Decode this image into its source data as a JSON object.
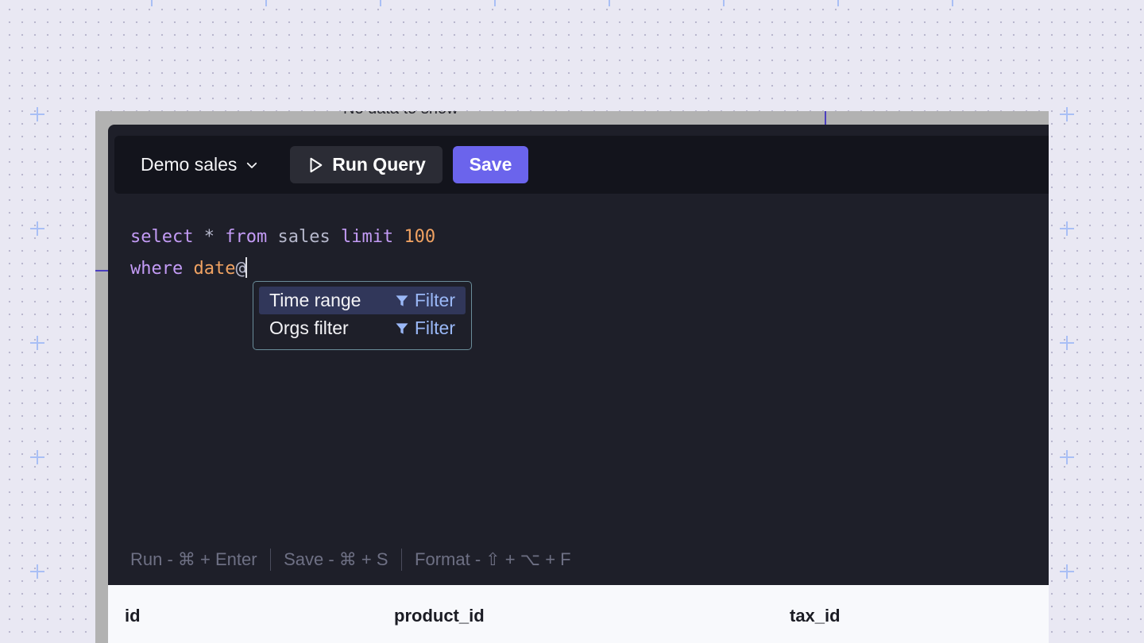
{
  "background_page": {
    "empty_text": "No data to show"
  },
  "toolbar": {
    "database_label": "Demo sales",
    "run_label": "Run Query",
    "save_label": "Save"
  },
  "editor": {
    "line1": {
      "kw_select": "select",
      "star": "*",
      "kw_from": "from",
      "table": "sales",
      "kw_limit": "limit",
      "limit_value": "100"
    },
    "line2": {
      "kw_where": "where",
      "column": "date",
      "trigger": "@"
    }
  },
  "suggestions": [
    {
      "label": "Time range",
      "tag": "Filter",
      "active": true
    },
    {
      "label": "Orgs filter",
      "tag": "Filter",
      "active": false
    }
  ],
  "shortcuts": [
    "Run - ⌘ + Enter",
    "Save - ⌘ + S",
    "Format - ⇧ + ⌥ + F"
  ],
  "results_table": {
    "columns": [
      "id",
      "product_id",
      "tax_id"
    ]
  },
  "colors": {
    "accent": "#6b64ec",
    "editor_bg": "#1e1f29",
    "keyword": "#c39bf5",
    "number": "#f0a262",
    "suggestion_border": "#6a8d9a",
    "filter_tag": "#9ab8f7"
  },
  "icons": {
    "database_dropdown": "chevron-down-icon",
    "run": "play-icon",
    "filter": "filter-icon"
  }
}
